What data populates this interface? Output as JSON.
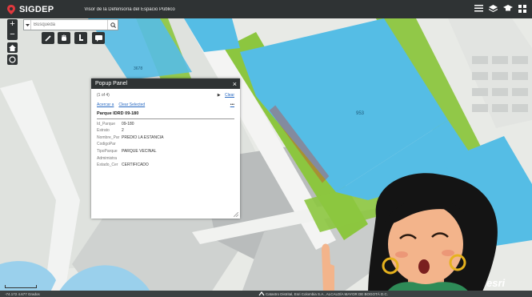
{
  "header": {
    "app_title": "SIGDEP",
    "subtitle": "Visor de la Defensoría del Espacio Público"
  },
  "header_icons": [
    "list-icon",
    "layers-icon",
    "graduation-icon",
    "grid-icon"
  ],
  "search": {
    "placeholder": "Búsqueda",
    "value": "Búsqueda"
  },
  "zoom": {
    "in": "+",
    "out": "−"
  },
  "map_labels": {
    "lot_953": "953",
    "lot_3678": "3678"
  },
  "popup": {
    "title": "Popup Panel",
    "close": "×",
    "counter": "(1 of 4)",
    "play": "▶",
    "clear": "Clear",
    "zoom_link": "Acercar a",
    "clear_selected": "Clear Selected",
    "more": "•••",
    "feature_title": "Parque IDRD 09-180",
    "attributes": [
      {
        "key": "Id_Parque",
        "value": "09-180"
      },
      {
        "key": "Estrato",
        "value": "2"
      },
      {
        "key": "Nombre_Par",
        "value": "PREDIO LA ESTANCIA"
      },
      {
        "key": "CodigoPar",
        "value": ""
      },
      {
        "key": "TipoParque",
        "value": "PARQUE VECINAL"
      },
      {
        "key": "Admimistra",
        "value": ""
      },
      {
        "key": "Estado_Cer",
        "value": "CERTIFICADO"
      }
    ]
  },
  "footer": {
    "coords": "-74.172 4.677 Grados",
    "attribution": "Catastro Distrital, Esri Colombia S.A., ALCALDÍA MAYOR DE BOGOTÁ D.C."
  },
  "colors": {
    "header_bg": "#2f3334",
    "parcel_blue": "#55bde5",
    "park_green": "#8cc63f",
    "selection_red": "#d9301f",
    "link_blue": "#2a6ac2"
  }
}
